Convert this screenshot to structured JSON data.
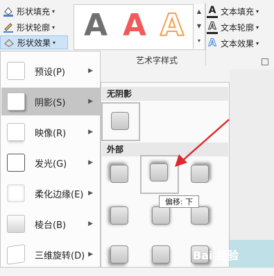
{
  "ribbon": {
    "shape_fill": "形状填充",
    "shape_outline": "形状轮廓",
    "shape_effects": "形状效果",
    "wordart_group_label": "艺术字样式",
    "text_fill": "文本填充",
    "text_outline": "文本轮廓",
    "text_effects": "文本效果",
    "wordart_samples": [
      "A",
      "A",
      "A"
    ],
    "wordart_colors": [
      "#707070",
      "#ef5a5a",
      "#f4a04e"
    ]
  },
  "effects_menu": {
    "items": [
      {
        "label": "预设(P)"
      },
      {
        "label": "阴影(S)"
      },
      {
        "label": "映像(R)"
      },
      {
        "label": "发光(G)"
      },
      {
        "label": "柔化边缘(E)"
      },
      {
        "label": "棱台(B)"
      },
      {
        "label": "三维旋转(D)"
      }
    ]
  },
  "shadow_submenu": {
    "section_no_shadow": "无阴影",
    "section_outer": "外部",
    "tooltip": "偏移: 下"
  },
  "watermark": "Bai 经验",
  "colors": {
    "menu_highlight": "#c5c5c5",
    "arrow": "#e0262e",
    "header_bg": "#e8e8e8"
  }
}
